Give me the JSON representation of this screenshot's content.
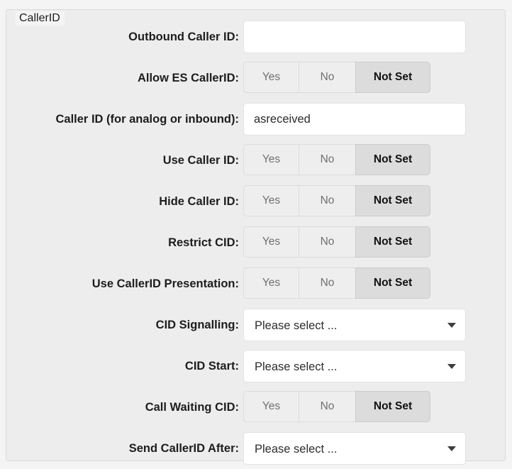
{
  "fieldset": {
    "legend": "CallerID"
  },
  "toggle_options": {
    "yes": "Yes",
    "no": "No",
    "not_set": "Not Set"
  },
  "select_placeholder": "Please select ...",
  "rows": [
    {
      "label": "Outbound Caller ID:",
      "type": "text",
      "value": "",
      "placeholder": ""
    },
    {
      "label": "Allow ES CallerID:",
      "type": "toggle",
      "selected": "Not Set"
    },
    {
      "label": "Caller ID (for analog or inbound):",
      "type": "text",
      "value": "asreceived",
      "placeholder": ""
    },
    {
      "label": "Use Caller ID:",
      "type": "toggle",
      "selected": "Not Set"
    },
    {
      "label": "Hide Caller ID:",
      "type": "toggle",
      "selected": "Not Set"
    },
    {
      "label": "Restrict CID:",
      "type": "toggle",
      "selected": "Not Set"
    },
    {
      "label": "Use CallerID Presentation:",
      "type": "toggle",
      "selected": "Not Set"
    },
    {
      "label": "CID Signalling:",
      "type": "select",
      "value": "Please select ..."
    },
    {
      "label": "CID Start:",
      "type": "select",
      "value": "Please select ..."
    },
    {
      "label": "Call Waiting CID:",
      "type": "toggle",
      "selected": "Not Set"
    },
    {
      "label": "Send CallerID After:",
      "type": "select",
      "value": "Please select ..."
    }
  ],
  "colors": {
    "page_background": "#f4f4f4",
    "panel_background": "#ededed",
    "panel_border": "#dadada",
    "input_background": "#ffffff",
    "input_border": "#e3e3e3",
    "toggle_inactive_background": "#eeeeee",
    "toggle_inactive_text": "#707070",
    "toggle_active_background": "#dcdcdc",
    "toggle_active_text": "#101010",
    "label_text": "#1d1d1d"
  }
}
